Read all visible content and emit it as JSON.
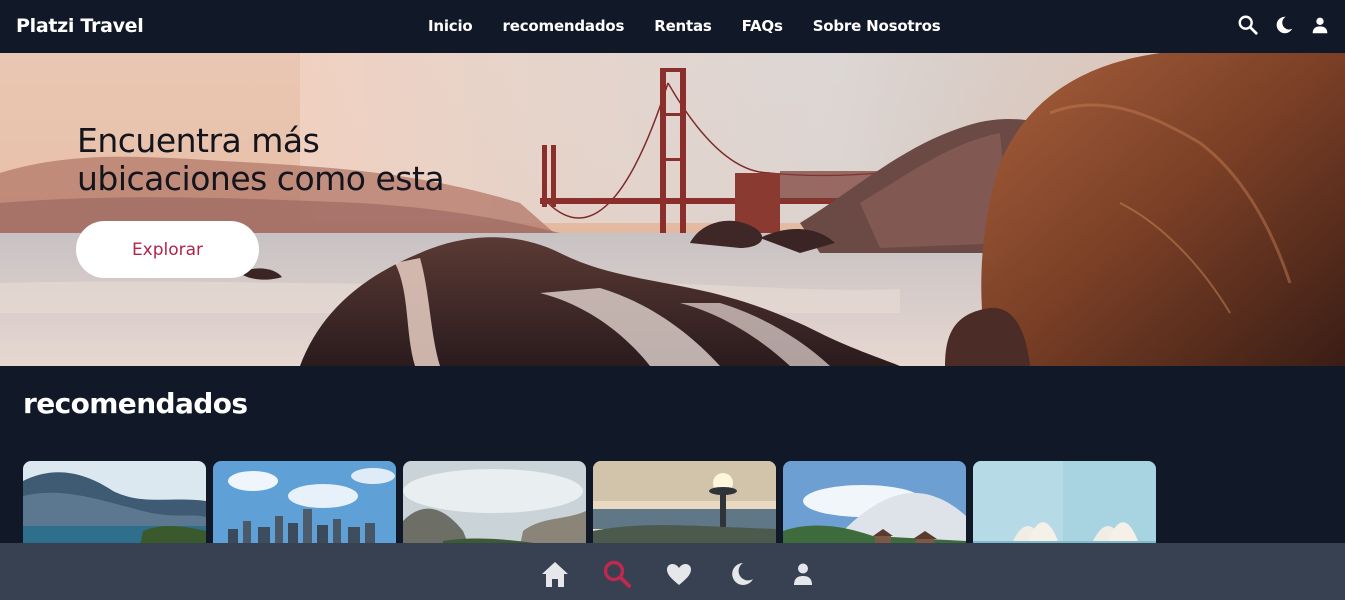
{
  "header": {
    "brand": "Platzi Travel",
    "nav": [
      "Inicio",
      "recomendados",
      "Rentas",
      "FAQs",
      "Sobre Nosotros"
    ],
    "icons": [
      "search-icon",
      "moon-icon",
      "user-icon"
    ]
  },
  "hero": {
    "title_line1": "Encuentra más",
    "title_line2": "ubicaciones como esta",
    "button_label": "Explorar"
  },
  "recommended": {
    "title": "recomendados",
    "cards": [
      "lake-mountains",
      "city-skyline",
      "valley-cliffs",
      "space-needle-city",
      "alpine-village",
      "opera-house"
    ]
  },
  "bottom_nav": {
    "icons": [
      "home-icon",
      "search-icon",
      "heart-icon",
      "moon-icon",
      "user-icon"
    ],
    "active_color": "#c0284f",
    "inactive_color": "#e5e7eb"
  },
  "colors": {
    "header_bg": "#111827",
    "bottom_bg": "#374151",
    "accent": "#b3244a"
  }
}
